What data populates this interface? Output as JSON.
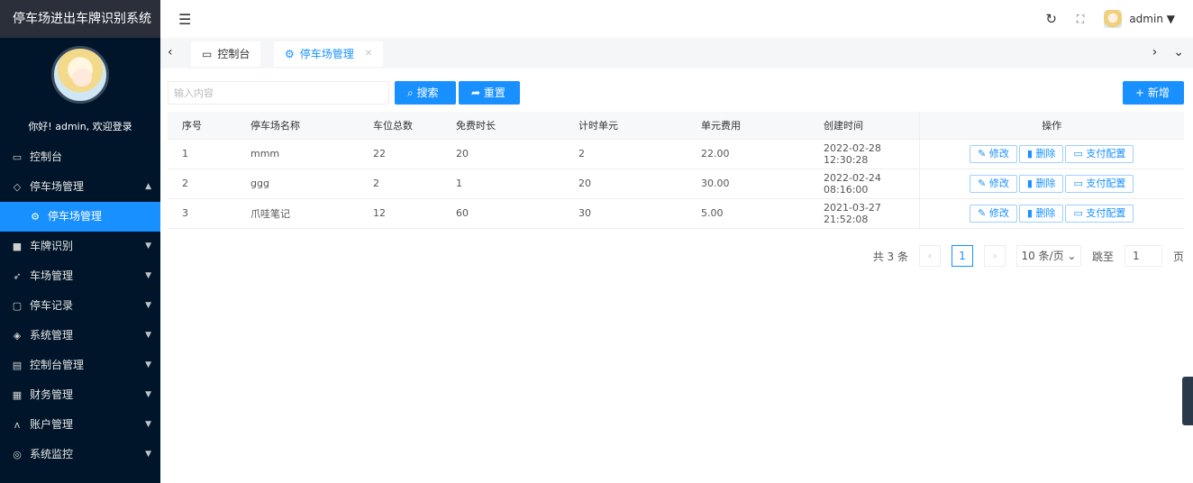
{
  "sidebar": {
    "brand": "停车场进出车牌识别系统",
    "welcome": "你好! admin, 欢迎登录",
    "items": [
      {
        "label": "控制台",
        "icon": "monitor-icon"
      },
      {
        "label": "停车场管理",
        "icon": "diamond-icon"
      },
      {
        "label": "停车场管理",
        "icon": "gear-icon"
      },
      {
        "label": "车牌识别",
        "icon": "camera-icon"
      },
      {
        "label": "车场管理",
        "icon": "send-icon"
      },
      {
        "label": "停车记录",
        "icon": "note-icon"
      },
      {
        "label": "系统管理",
        "icon": "layers-icon"
      },
      {
        "label": "控制台管理",
        "icon": "clipboard-icon"
      },
      {
        "label": "财务管理",
        "icon": "grid-icon"
      },
      {
        "label": "账户管理",
        "icon": "user-icon"
      },
      {
        "label": "系统监控",
        "icon": "camera-icon"
      }
    ]
  },
  "topbar": {
    "user": "admin"
  },
  "tabs": [
    {
      "label": "控制台"
    },
    {
      "label": "停车场管理"
    }
  ],
  "toolbar": {
    "search_placeholder": "输入内容",
    "search_label": "搜索",
    "reset_label": "重置",
    "add_label": "新增"
  },
  "table": {
    "columns": [
      "序号",
      "停车场名称",
      "车位总数",
      "免费时长",
      "计时单元",
      "单元费用",
      "创建时间",
      "操作"
    ],
    "rows": [
      [
        "1",
        "mmm",
        "22",
        "20",
        "2",
        "22.00",
        "2022-02-28 12:30:28"
      ],
      [
        "2",
        "ggg",
        "2",
        "1",
        "20",
        "30.00",
        "2022-02-24 08:16:00"
      ],
      [
        "3",
        "爪哇笔记",
        "12",
        "60",
        "30",
        "5.00",
        "2021-03-27 21:52:08"
      ]
    ],
    "actions": {
      "edit": "修改",
      "delete": "删除",
      "pay": "支付配置"
    }
  },
  "pager": {
    "total": "共 3 条",
    "current": "1",
    "page_size": "10 条/页",
    "jump_label": "跳至",
    "jump_value": "1",
    "page_suffix": "页"
  },
  "colors": {
    "primary": "#1890ff",
    "sidebar": "#001529",
    "brand_bg": "#2b2f3a"
  }
}
